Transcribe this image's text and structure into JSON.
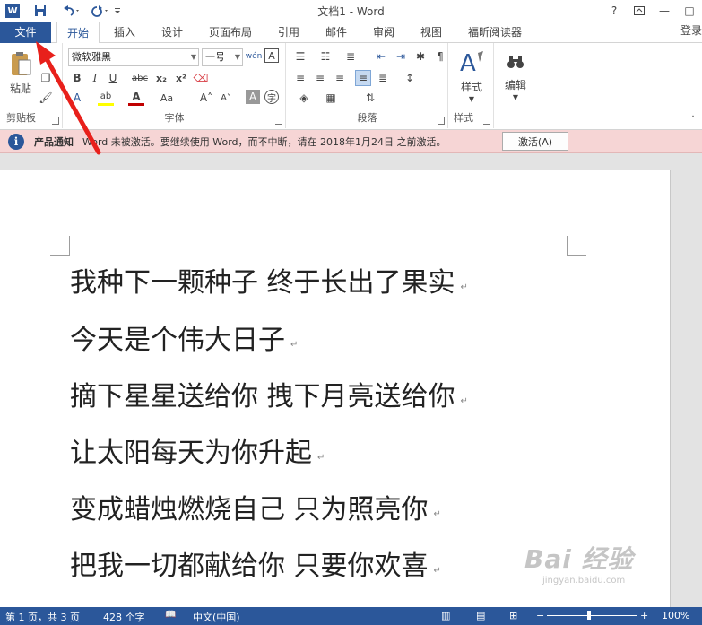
{
  "window": {
    "title": "文档1 - Word",
    "app_icon": "W",
    "help": "?",
    "restore_icon": "ribbon-display-icon",
    "minimize": "—",
    "maximize": "□"
  },
  "tabs": [
    "文件",
    "开始",
    "插入",
    "设计",
    "页面布局",
    "引用",
    "邮件",
    "审阅",
    "视图",
    "福昕阅读器"
  ],
  "signin": "登录",
  "ribbon": {
    "clipboard": {
      "label": "剪贴板",
      "paste": "粘贴"
    },
    "font": {
      "label": "字体",
      "font_name": "微软雅黑",
      "font_size": "一号",
      "wen": "wén"
    },
    "paragraph": {
      "label": "段落"
    },
    "styles": {
      "label": "样式",
      "button": "样式"
    },
    "editing": {
      "button": "编辑"
    }
  },
  "notice": {
    "title": "产品通知",
    "message": "Word 未被激活。要继续使用 Word，而不中断，请在 2018年1月24日 之前激活。",
    "button": "激活(A)"
  },
  "document": {
    "lines": [
      "我种下一颗种子  终于长出了果实",
      "今天是个伟大日子",
      "摘下星星送给你  拽下月亮送给你",
      "让太阳每天为你升起",
      "变成蜡烛燃烧自己  只为照亮你",
      "把我一切都献给你  只要你欢喜"
    ],
    "paragraph_mark": "↵"
  },
  "watermark": {
    "main": "Bai 经验",
    "sub": "jingyan.baidu.com"
  },
  "status": {
    "page": "第 1 页，共 3 页",
    "words": "428 个字",
    "language": "中文(中国)",
    "zoom": "100%",
    "zoom_level": 1.0
  }
}
